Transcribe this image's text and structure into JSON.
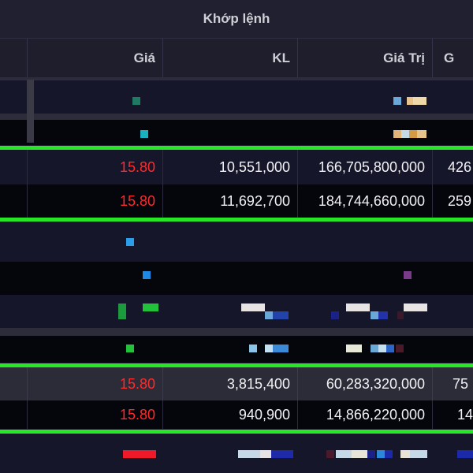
{
  "header": {
    "title": "Khớp lệnh"
  },
  "columns": [
    "Giá",
    "KL",
    "Giá Trị",
    "G"
  ],
  "rows": [
    {
      "price": "15.80",
      "volume": "10,551,000",
      "value": "166,705,800,000",
      "extra": "426"
    },
    {
      "price": "15.80",
      "volume": "11,692,700",
      "value": "184,744,660,000",
      "extra": "259"
    },
    {
      "price": "15.80",
      "volume": "3,815,400",
      "value": "60,283,320,000",
      "extra": "75"
    },
    {
      "price": "15.80",
      "volume": "940,900",
      "value": "14,866,220,000",
      "extra": "14"
    }
  ],
  "colors": {
    "price_down": "#ff2a2a",
    "highlight_line": "#27e627"
  }
}
